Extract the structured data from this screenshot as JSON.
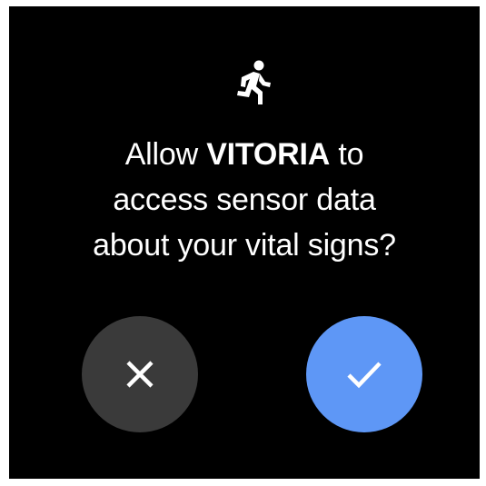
{
  "dialog": {
    "icon": "running-person-icon",
    "prompt_prefix": "Allow",
    "app_name": "VITORIA",
    "prompt_suffix": "to",
    "prompt_line2": "access sensor data",
    "prompt_line3": "about your vital signs?"
  },
  "actions": {
    "deny_icon": "close-icon",
    "allow_icon": "check-icon",
    "deny_color": "#3a3a3a",
    "allow_color": "#5e97f6"
  }
}
